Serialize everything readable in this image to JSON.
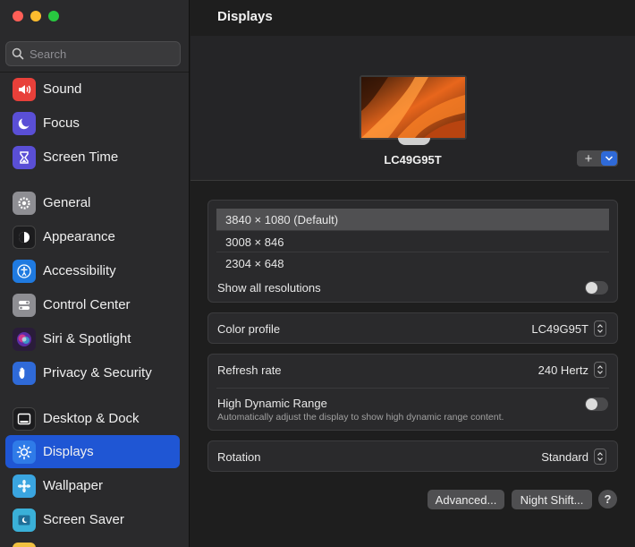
{
  "window": {
    "title": "Displays"
  },
  "search": {
    "placeholder": "Search"
  },
  "sidebar": {
    "items": [
      {
        "label": "Sound",
        "icon": "speaker-icon",
        "color": "#e8403a"
      },
      {
        "label": "Focus",
        "icon": "moon-icon",
        "color": "#5a4fd6"
      },
      {
        "label": "Screen Time",
        "icon": "hourglass-icon",
        "color": "#5a4fd6"
      },
      {
        "label": "General",
        "icon": "gear-icon",
        "color": "#8e8e93"
      },
      {
        "label": "Appearance",
        "icon": "appearance-icon",
        "color": "#1c1c1e"
      },
      {
        "label": "Accessibility",
        "icon": "accessibility-icon",
        "color": "#1f7ae0"
      },
      {
        "label": "Control Center",
        "icon": "toggles-icon",
        "color": "#8e8e93"
      },
      {
        "label": "Siri & Spotlight",
        "icon": "siri-icon",
        "color": "#8a2be2"
      },
      {
        "label": "Privacy & Security",
        "icon": "hand-icon",
        "color": "#2f6ad8"
      },
      {
        "label": "Desktop & Dock",
        "icon": "dock-icon",
        "color": "#1c1c1e"
      },
      {
        "label": "Displays",
        "icon": "sun-icon",
        "color": "#2f7be8",
        "active": true
      },
      {
        "label": "Wallpaper",
        "icon": "wallpaper-icon",
        "color": "#3aa5e0"
      },
      {
        "label": "Screen Saver",
        "icon": "screensaver-icon",
        "color": "#3ab0d8"
      }
    ]
  },
  "display": {
    "name": "LC49G95T"
  },
  "resolutions": {
    "options": [
      "3840 × 1080 (Default)",
      "3008 × 846",
      "2304 × 648"
    ],
    "selected_index": 0,
    "show_all_label": "Show all resolutions",
    "show_all_on": false
  },
  "color_profile": {
    "label": "Color profile",
    "value": "LC49G95T"
  },
  "refresh": {
    "label": "Refresh rate",
    "value": "240 Hertz"
  },
  "hdr": {
    "label": "High Dynamic Range",
    "description": "Automatically adjust the display to show high dynamic range content.",
    "on": false
  },
  "rotation": {
    "label": "Rotation",
    "value": "Standard"
  },
  "buttons": {
    "advanced": "Advanced...",
    "night_shift": "Night Shift...",
    "help": "?",
    "add": "+"
  },
  "colors": {
    "accent": "#1f56d4",
    "background": "#1e1e1e",
    "sidebar": "#2a2a2c"
  }
}
